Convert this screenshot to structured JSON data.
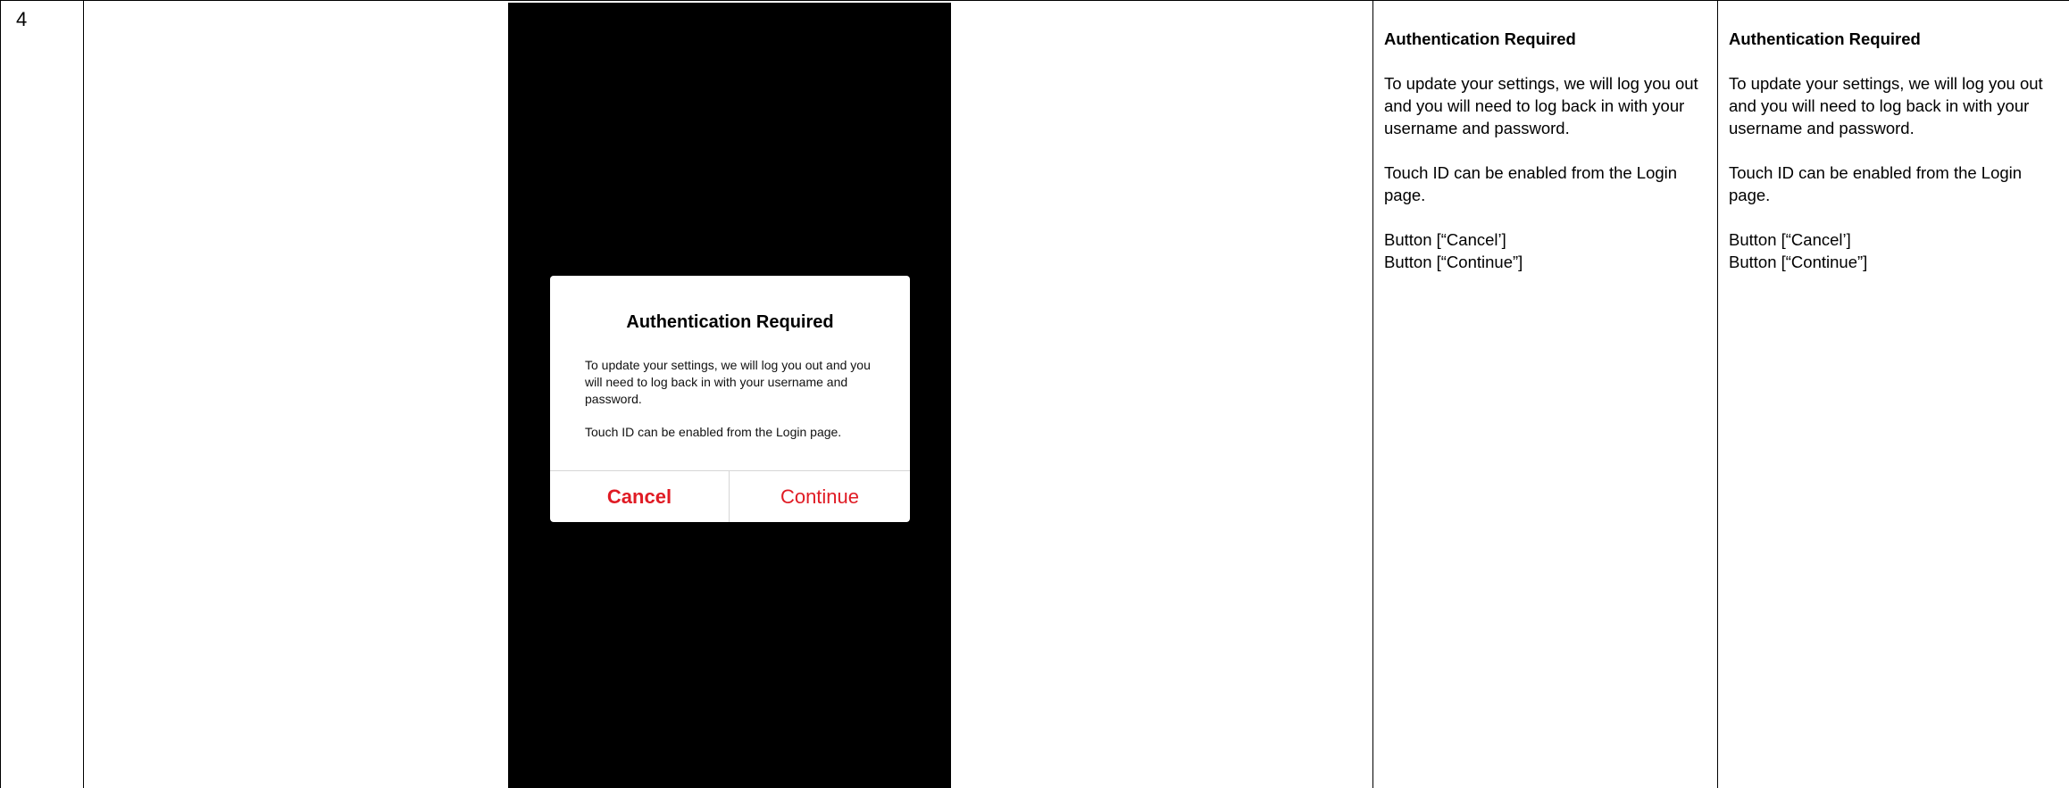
{
  "row": {
    "number": "4"
  },
  "dialog": {
    "title": "Authentication Required",
    "message_line1": "To update your settings, we will log you out and you will need to log back in with your username and password.",
    "message_line2": "Touch ID can be enabled from the Login page.",
    "cancel_label": "Cancel",
    "continue_label": "Continue"
  },
  "spec_a": {
    "title": "Authentication Required",
    "para1": "To update your settings, we will log you out and you will need to log back in with your username and password.",
    "para2": "Touch ID can be enabled from the Login page.",
    "button1": "Button [“Cancel’]",
    "button2": "Button [“Continue”]"
  },
  "spec_b": {
    "title": "Authentication Required",
    "para1": "To update your settings, we will log you out and you will need to log back in with your username and password.",
    "para2": "Touch ID can be enabled from the Login page.",
    "button1": "Button [“Cancel’]",
    "button2": "Button [“Continue”]"
  },
  "colors": {
    "accent_red": "#e01b24",
    "phone_background": "#000000",
    "divider": "#d6d6d6"
  }
}
